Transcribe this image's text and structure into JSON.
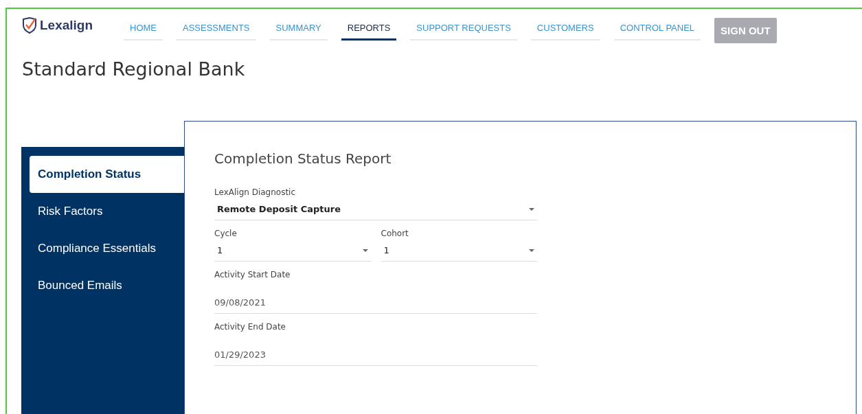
{
  "brand": {
    "name": "Lexalign"
  },
  "nav": [
    {
      "label": "HOME",
      "selected": false
    },
    {
      "label": "ASSESSMENTS",
      "selected": false
    },
    {
      "label": "SUMMARY",
      "selected": false
    },
    {
      "label": "REPORTS",
      "selected": true
    },
    {
      "label": "SUPPORT REQUESTS",
      "selected": false
    },
    {
      "label": "CUSTOMERS",
      "selected": false
    },
    {
      "label": "CONTROL PANEL",
      "selected": false
    }
  ],
  "sign_out": "SIGN OUT",
  "page_title": "Standard Regional Bank",
  "sidebar": {
    "items": [
      {
        "label": "Completion Status",
        "selected": true
      },
      {
        "label": "Risk Factors",
        "selected": false
      },
      {
        "label": "Compliance Essentials",
        "selected": false
      },
      {
        "label": "Bounced Emails",
        "selected": false
      }
    ]
  },
  "report": {
    "title": "Completion Status Report",
    "fields": [
      {
        "kind": "select",
        "label": "LexAlign Diagnostic",
        "value": "Remote Deposit Capture"
      },
      {
        "kind": "select-pair",
        "items": [
          {
            "label": "Cycle",
            "value": "1"
          },
          {
            "label": "Cohort",
            "value": "1"
          }
        ]
      },
      {
        "kind": "date",
        "label": "Activity Start Date",
        "value": "09/08/2021"
      },
      {
        "kind": "date",
        "label": "Activity End Date",
        "value": "01/29/2023"
      }
    ]
  }
}
